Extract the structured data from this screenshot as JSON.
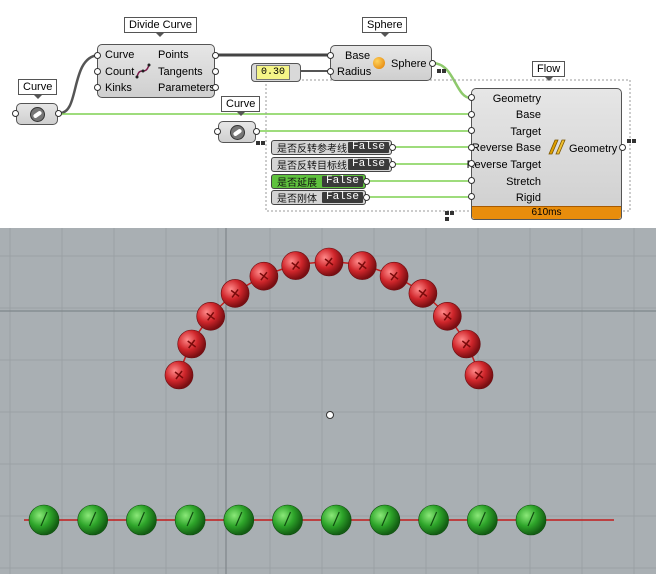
{
  "grasshopper": {
    "divide_curve": {
      "title": "Divide Curve",
      "inputs": [
        "Curve",
        "Count",
        "Kinks"
      ],
      "outputs": [
        "Points",
        "Tangents",
        "Parameters"
      ]
    },
    "sphere": {
      "title": "Sphere",
      "inputs": [
        "Base",
        "Radius"
      ],
      "output": "Sphere"
    },
    "radius_value": "0.30",
    "curve_param_left": "Curve",
    "curve_param_mid": "Curve",
    "flow": {
      "title": "Flow",
      "inputs": [
        "Geometry",
        "Base",
        "Target",
        "Reverse Base",
        "Reverse Target",
        "Stretch",
        "Rigid"
      ],
      "output": "Geometry",
      "time": "610ms"
    },
    "toggles": [
      {
        "label": "是否反转参考线",
        "value": "False",
        "active": false
      },
      {
        "label": "是否反转目标线",
        "value": "False",
        "active": false
      },
      {
        "label": "是否延展",
        "value": "False",
        "active": true
      },
      {
        "label": "是否刚体",
        "value": "False",
        "active": false
      }
    ]
  },
  "viewport": {
    "background": "#a9afb3",
    "grid_color": "#9ba1a5",
    "curve_color": "#c31d1d",
    "red_sphere_count": 13,
    "green_sphere_count": 11
  }
}
